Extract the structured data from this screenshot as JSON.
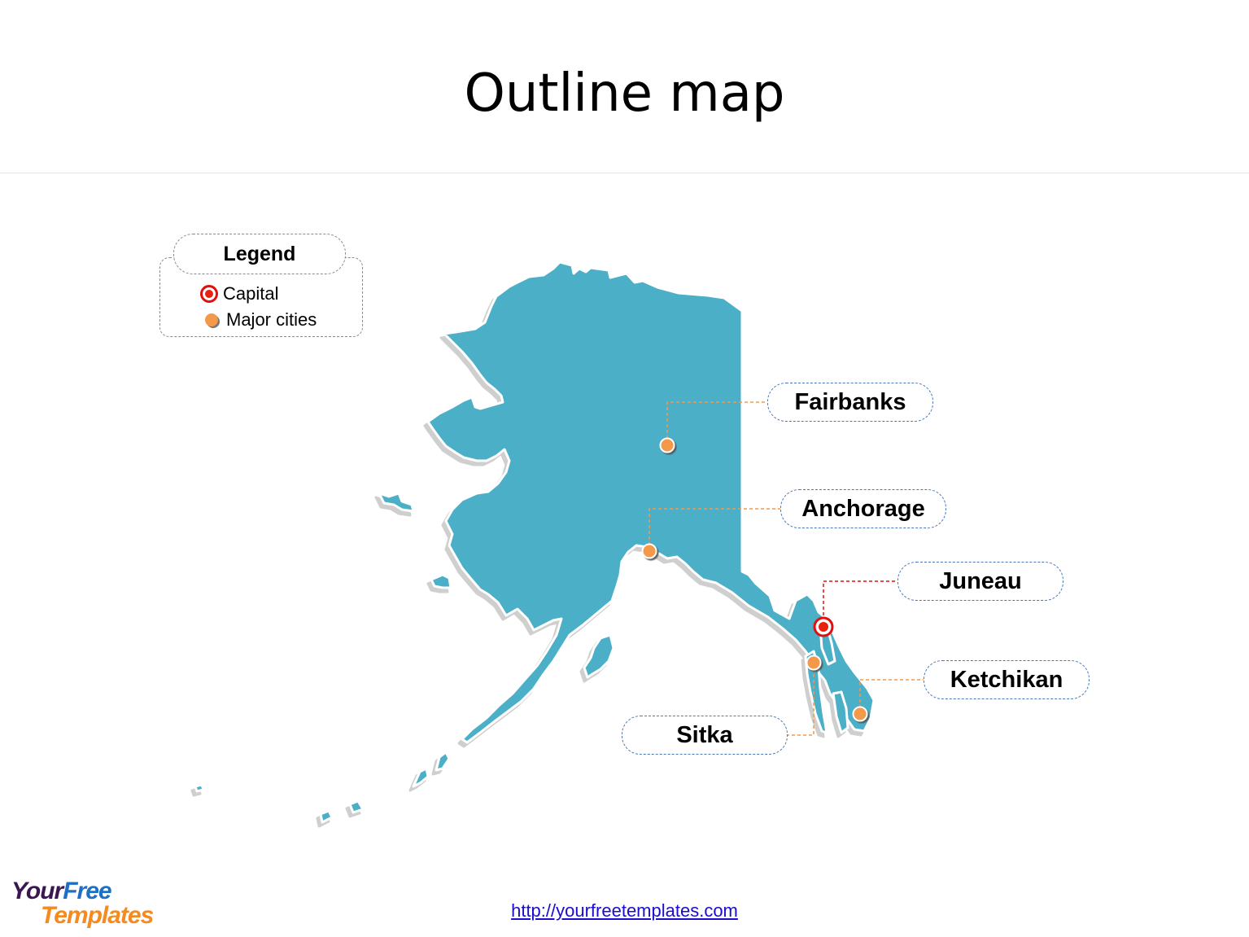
{
  "slide": {
    "title": "Outline map",
    "footer_link": "http://yourfreetemplates.com"
  },
  "logo": {
    "line1_part1": "Your",
    "line1_part2": "Free",
    "line2": "Templates"
  },
  "legend": {
    "heading": "Legend",
    "items": [
      {
        "symbol": "capital-marker-icon",
        "label": "Capital"
      },
      {
        "symbol": "city-marker-icon",
        "label": "Major cities"
      }
    ]
  },
  "map": {
    "region": "Alaska",
    "fill_color": "#4bafc8",
    "outline_color": "#ffffff",
    "shadow_color": "#cfcfcf",
    "capital_color": "#e01010",
    "city_color": "#f4994a",
    "label_border_color": "#4a78b8",
    "cities": [
      {
        "name": "Fairbanks",
        "type": "major-city"
      },
      {
        "name": "Anchorage",
        "type": "major-city"
      },
      {
        "name": "Juneau",
        "type": "capital"
      },
      {
        "name": "Ketchikan",
        "type": "major-city"
      },
      {
        "name": "Sitka",
        "type": "major-city"
      }
    ]
  },
  "colors": {
    "logo_your": "#3b1650",
    "logo_free": "#1f6fc4",
    "logo_templates": "#f58a1f",
    "logo_p": "#d8262a"
  }
}
